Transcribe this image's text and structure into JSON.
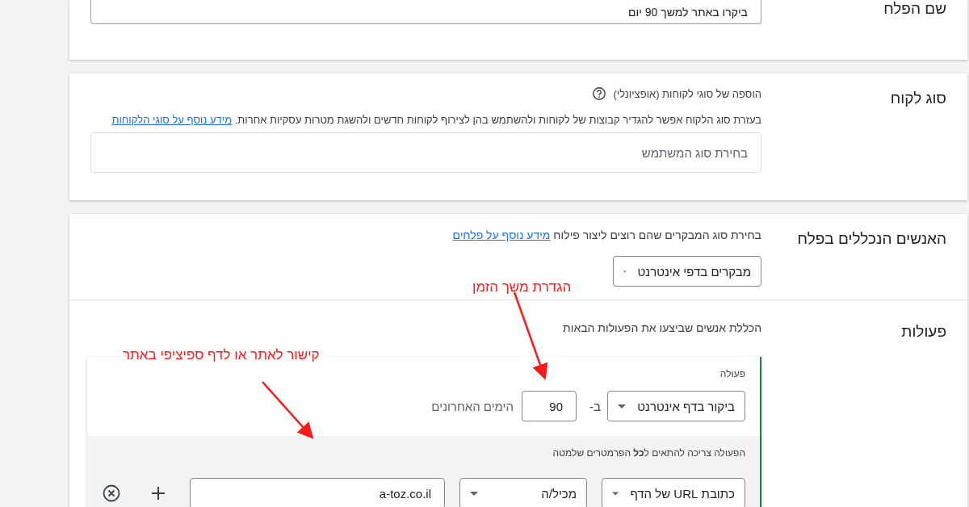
{
  "segment_name": {
    "label": "שם הפלח",
    "value": "ביקרו באתר למשך 90 יום"
  },
  "customer_type": {
    "label": "סוג לקוח",
    "heading": "הוספה של סוגי לקוחות (אופציונלי)",
    "description": "בעזרת סוג הלקוח אפשר להגדיר קבוצות של לקוחות ולהשתמש בהן לצירוף לקוחות חדשים ולהשגת מטרות עסקיות אחרות.",
    "link": "מידע נוסף על סוגי הלקוחות",
    "placeholder": "בחירת סוג המשתמש"
  },
  "people": {
    "label": "האנשים הנכללים בפלח",
    "description": "בחירת סוג המבקרים שהם רוצים ליצור פילוח",
    "link": "מידע נוסף על פלחים",
    "dropdown": "מבקרים בדפי אינטרנט"
  },
  "actions": {
    "label": "פעולות",
    "description": "הכללת אנשים שביצעו את הפעולות הבאות",
    "action_label": "פעולה",
    "action_dropdown": "ביקור בדף אינטרנט",
    "in_label": "ב-",
    "days_value": "90",
    "days_suffix": "הימים האחרונים",
    "rule_note": "הפעולה צריכה להתאים ל**כל** הפרמטרים שלמטה",
    "rule": {
      "field_dropdown": "כתובת URL של הדף",
      "operator_dropdown": "מכיל/ה",
      "value": "a-toz.co.il"
    }
  },
  "annotations": [
    {
      "text": "הגדרת משך הזמן"
    },
    {
      "text": "קישור לאתר או לדף ספיציפי באתר"
    }
  ]
}
